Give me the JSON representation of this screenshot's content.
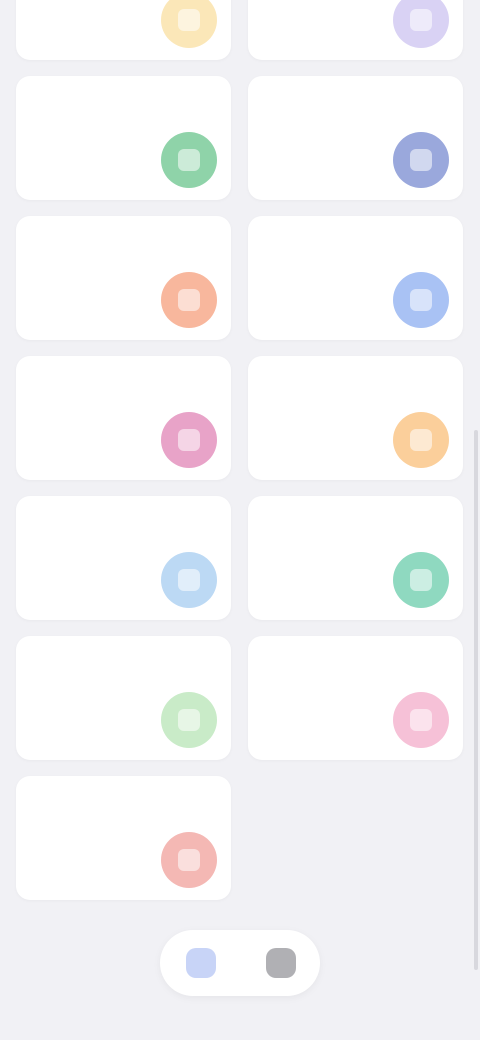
{
  "status_bar": {
    "icons": [
      "dynamic-island",
      "signal-icon",
      "wifi-icon",
      "battery-icon"
    ]
  },
  "cards": [
    {
      "id": "card-1",
      "title": "",
      "subtitle": "",
      "icon": "sun-icon",
      "color": "#fbe7b8"
    },
    {
      "id": "card-2",
      "title": "",
      "subtitle": "",
      "icon": "moon-icon",
      "color": "#d9d2f4"
    },
    {
      "id": "card-3",
      "title": "",
      "subtitle": "",
      "icon": "leaf-icon",
      "color": "#8fd3a9"
    },
    {
      "id": "card-4",
      "title": "",
      "subtitle": "",
      "icon": "grid-icon",
      "color": "#9aa8dc"
    },
    {
      "id": "card-5",
      "title": "",
      "subtitle": "",
      "icon": "flame-icon",
      "color": "#f8b79d"
    },
    {
      "id": "card-6",
      "title": "",
      "subtitle": "",
      "icon": "drop-icon",
      "color": "#a9c2f4"
    },
    {
      "id": "card-7",
      "title": "",
      "subtitle": "",
      "icon": "heart-icon",
      "color": "#e8a3c8"
    },
    {
      "id": "card-8",
      "title": "",
      "subtitle": "",
      "icon": "star-icon",
      "color": "#fbcf9b"
    },
    {
      "id": "card-9",
      "title": "",
      "subtitle": "",
      "icon": "cloud-icon",
      "color": "#bcd9f4"
    },
    {
      "id": "card-10",
      "title": "",
      "subtitle": "",
      "icon": "chart-icon",
      "color": "#8fd9c0"
    },
    {
      "id": "card-11",
      "title": "",
      "subtitle": "",
      "icon": "check-icon",
      "color": "#c9ebc8"
    },
    {
      "id": "card-12",
      "title": "",
      "subtitle": "",
      "icon": "flower-icon",
      "color": "#f6c1d7"
    },
    {
      "id": "card-13",
      "title": "",
      "subtitle": "",
      "icon": "bell-icon",
      "color": "#f4b8b4"
    }
  ],
  "bottom_nav": {
    "items": [
      {
        "id": "nav-home",
        "icon": "home-icon",
        "color": "#c8d4f7"
      },
      {
        "id": "nav-profile",
        "icon": "profile-icon",
        "color": "#b0b0b4"
      }
    ]
  }
}
